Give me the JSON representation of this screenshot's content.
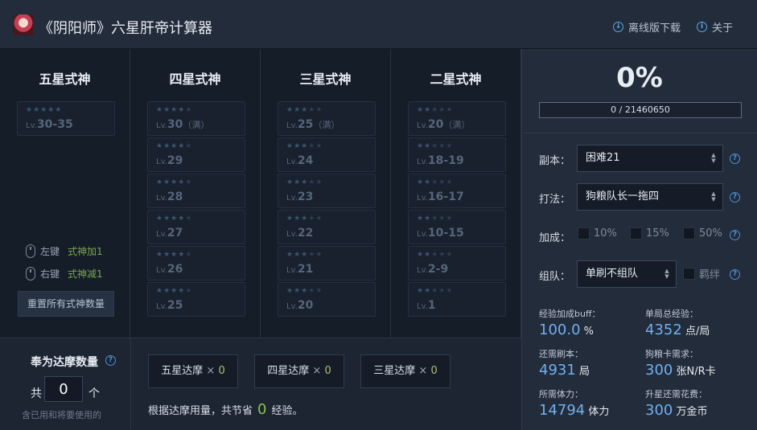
{
  "header": {
    "title": "《阴阳师》六星肝帝计算器",
    "download_label": "离线版下载",
    "about_label": "关于"
  },
  "columns": [
    {
      "title": "五星式神",
      "stars_on": 5,
      "cards": [
        {
          "lv": "30-35",
          "note": ""
        }
      ]
    },
    {
      "title": "四星式神",
      "stars_on": 4,
      "cards": [
        {
          "lv": "30",
          "note": "（满）"
        },
        {
          "lv": "29",
          "note": ""
        },
        {
          "lv": "28",
          "note": ""
        },
        {
          "lv": "27",
          "note": ""
        },
        {
          "lv": "26",
          "note": ""
        },
        {
          "lv": "25",
          "note": ""
        }
      ]
    },
    {
      "title": "三星式神",
      "stars_on": 3,
      "cards": [
        {
          "lv": "25",
          "note": "（满）"
        },
        {
          "lv": "24",
          "note": ""
        },
        {
          "lv": "23",
          "note": ""
        },
        {
          "lv": "22",
          "note": ""
        },
        {
          "lv": "21",
          "note": ""
        },
        {
          "lv": "20",
          "note": ""
        }
      ]
    },
    {
      "title": "二星式神",
      "stars_on": 2,
      "cards": [
        {
          "lv": "20",
          "note": "（满）"
        },
        {
          "lv": "18-19",
          "note": ""
        },
        {
          "lv": "16-17",
          "note": ""
        },
        {
          "lv": "10-15",
          "note": ""
        },
        {
          "lv": "2-9",
          "note": ""
        },
        {
          "lv": "1",
          "note": ""
        }
      ]
    }
  ],
  "lv_prefix": "Lv.",
  "hints": {
    "left_key": "左键",
    "left_action": "式神加1",
    "right_key": "右键",
    "right_action": "式神减1",
    "reset_label": "重置所有式神数量"
  },
  "fodder": {
    "title": "奉为达摩数量",
    "gong": "共",
    "count": "0",
    "ge": "个",
    "note": "含已用和将要使用的",
    "buttons": [
      {
        "label": "五星达摩",
        "count": "0"
      },
      {
        "label": "四星达摩",
        "count": "0"
      },
      {
        "label": "三星达摩",
        "count": "0"
      }
    ],
    "times": "×",
    "saving_prefix": "根据达摩用量，共节省",
    "saving_value": "0",
    "saving_suffix": "经验。"
  },
  "progress": {
    "percent_text": "0%",
    "fraction": 0,
    "text": "0 / 21460650"
  },
  "form": {
    "dungeon_label": "副本：",
    "dungeon_value": "困难21",
    "strategy_label": "打法：",
    "strategy_value": "狗粮队长一拖四",
    "bonus_label": "加成：",
    "bonus_options": [
      "10%",
      "15%",
      "50%"
    ],
    "team_label": "组队：",
    "team_value": "单刷不组队",
    "bond_label": "羁绊"
  },
  "stats": {
    "buff_label": "经验加成buff：",
    "buff_value": "100.0",
    "buff_unit": "%",
    "exp_label": "单局总经验：",
    "exp_value": "4352",
    "exp_unit": "点/局",
    "runs_label": "还需刷本：",
    "runs_value": "4931",
    "runs_unit": "局",
    "cards_label": "狗粮卡需求：",
    "cards_value": "300",
    "cards_unit": "张N/R卡",
    "stamina_label": "所需体力：",
    "stamina_value": "14794",
    "stamina_unit": "体力",
    "gold_label": "升星还需花费：",
    "gold_value": "300",
    "gold_unit": "万金币"
  },
  "colors": {
    "accent_blue": "#6fb0f0",
    "accent_green": "#8bc34a",
    "progress_fill": "#3a7bd5"
  }
}
